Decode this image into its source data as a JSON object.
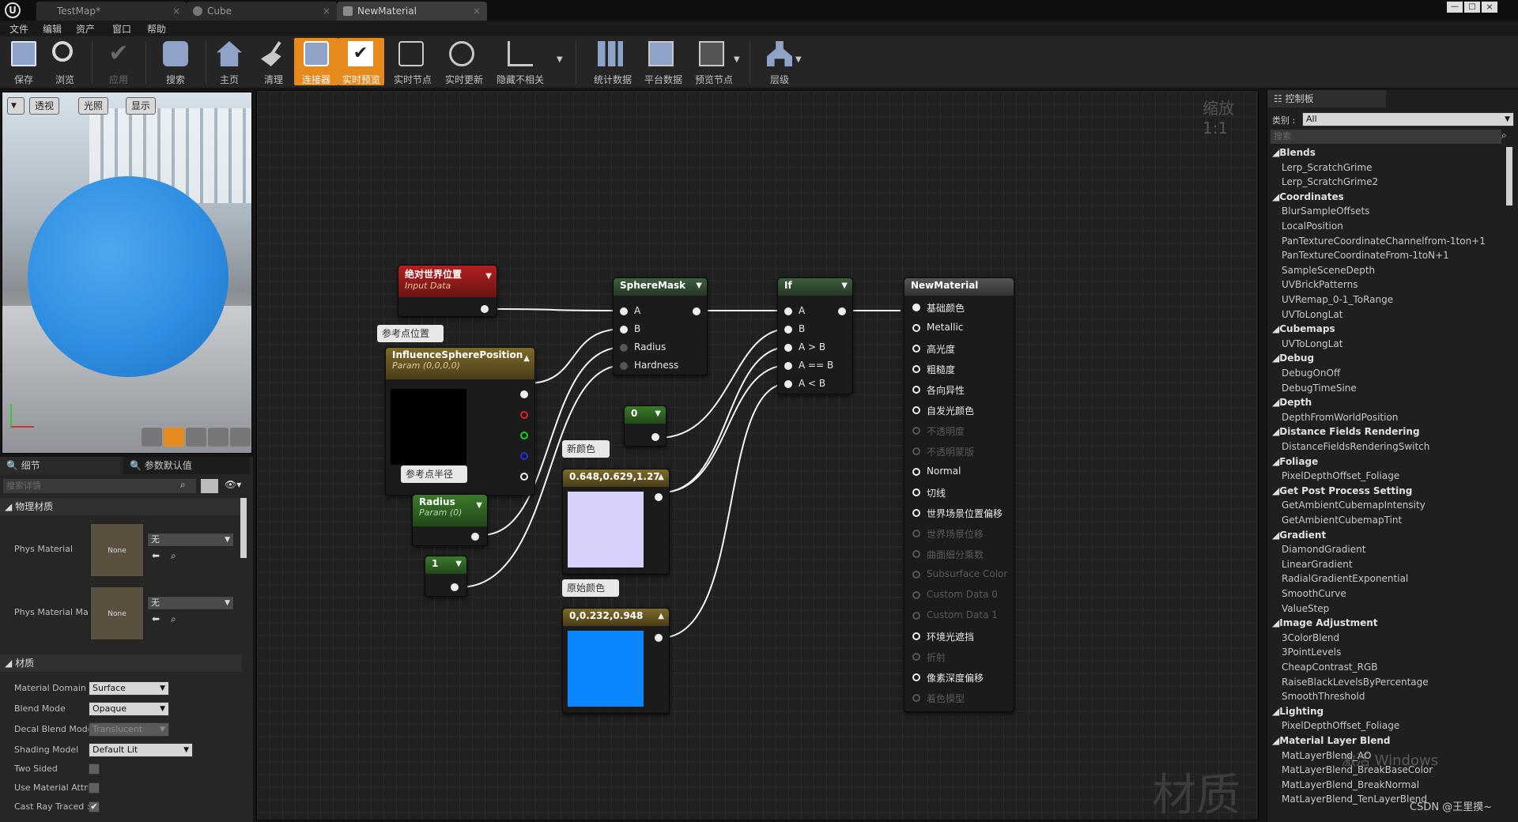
{
  "title_tabs": [
    {
      "label": "TestMap*"
    },
    {
      "label": "Cube"
    },
    {
      "label": "NewMaterial"
    }
  ],
  "menu": [
    "文件",
    "编辑",
    "资产",
    "窗口",
    "帮助"
  ],
  "toolbar": {
    "save": "保存",
    "browse": "浏览",
    "apply": "应用",
    "search": "搜索",
    "home": "主页",
    "clean": "清理",
    "connector": "连接器",
    "live_preview": "实时预览",
    "live_nodes": "实时节点",
    "live_update": "实时更新",
    "hide_unrelated": "隐藏不相关",
    "stats": "统计数据",
    "platform_stats": "平台数据",
    "preview_nodes": "预览节点",
    "hierarchy": "层级"
  },
  "viewport": {
    "perspective": "透视",
    "lit": "光照",
    "show": "显示"
  },
  "details": {
    "tab_details": "细节",
    "tab_params": "参数默认值",
    "search_placeholder": "搜索详情",
    "section_phys": "物理材质",
    "phys_material_label": "Phys Material",
    "phys_material_value": "无",
    "phys_material_thumb": "None",
    "phys_material_mask_label": "Phys Material Ma",
    "phys_material_mask_value": "无",
    "phys_material_mask_thumb": "None",
    "section_material": "材质",
    "domain_label": "Material Domain",
    "domain_value": "Surface",
    "blend_label": "Blend Mode",
    "blend_value": "Opaque",
    "decal_label": "Decal Blend Mode",
    "decal_value": "Translucent",
    "shading_label": "Shading Model",
    "shading_value": "Default Lit",
    "two_sided_label": "Two Sided",
    "use_attr_label": "Use Material Attri",
    "cast_ray_label": "Cast Ray Traced :"
  },
  "graph": {
    "zoom": "缩放1:1",
    "watermark": "材质",
    "node_world_pos": {
      "title": "绝对世界位置",
      "sub": "Input Data"
    },
    "comment_ref_pos": "参考点位置",
    "node_influence": {
      "title": "InfluenceSpherePosition",
      "sub": "Param (0,0,0,0)"
    },
    "comment_ref_radius": "参考点半径",
    "node_radius": {
      "title": "Radius",
      "sub": "Param (0)"
    },
    "node_const1": "1",
    "node_spheremask": {
      "title": "SphereMask",
      "pins": [
        "A",
        "B",
        "Radius",
        "Hardness"
      ]
    },
    "node_const0": "0",
    "comment_new_color": "新颜色",
    "node_color1": "0.648,0.629,1.27",
    "comment_orig_color": "原始颜色",
    "node_color2": "0,0.232,0.948",
    "node_if": {
      "title": "If",
      "pins": [
        "A",
        "B",
        "A > B",
        "A == B",
        "A < B"
      ]
    },
    "node_result": {
      "title": "NewMaterial",
      "pins": [
        "基础颜色",
        "Metallic",
        "高光度",
        "粗糙度",
        "各向异性",
        "自发光颜色",
        "不透明度",
        "不透明蒙版",
        "Normal",
        "切线",
        "世界场景位置偏移",
        "世界场景位移",
        "曲面细分乘数",
        "Subsurface Color",
        "Custom Data 0",
        "Custom Data 1",
        "环境光遮挡",
        "折射",
        "像素深度偏移",
        "着色模型"
      ]
    },
    "colors": {
      "swatch1": "#d6d2fb",
      "swatch2": "#0a86ff"
    }
  },
  "palette": {
    "tab": "控制板",
    "category_label": "类别 :",
    "category_value": "All",
    "search_placeholder": "搜索",
    "items": [
      {
        "t": "Blends",
        "cat": true
      },
      {
        "t": "Lerp_ScratchGrime"
      },
      {
        "t": "Lerp_ScratchGrime2"
      },
      {
        "t": "Coordinates",
        "cat": true
      },
      {
        "t": "BlurSampleOffsets"
      },
      {
        "t": "LocalPosition"
      },
      {
        "t": "PanTextureCoordinateChannelfrom-1ton+1"
      },
      {
        "t": "PanTextureCoordinateFrom-1toN+1"
      },
      {
        "t": "SampleSceneDepth"
      },
      {
        "t": "UVBrickPatterns"
      },
      {
        "t": "UVRemap_0-1_ToRange"
      },
      {
        "t": "UVToLongLat"
      },
      {
        "t": "Cubemaps",
        "cat": true
      },
      {
        "t": "UVToLongLat"
      },
      {
        "t": "Debug",
        "cat": true
      },
      {
        "t": "DebugOnOff"
      },
      {
        "t": "DebugTimeSine"
      },
      {
        "t": "Depth",
        "cat": true
      },
      {
        "t": "DepthFromWorldPosition"
      },
      {
        "t": "Distance Fields Rendering",
        "cat": true
      },
      {
        "t": "DistanceFieldsRenderingSwitch"
      },
      {
        "t": "Foliage",
        "cat": true
      },
      {
        "t": "PixelDepthOffset_Foliage"
      },
      {
        "t": "Get Post Process Setting",
        "cat": true
      },
      {
        "t": "GetAmbientCubemapIntensity"
      },
      {
        "t": "GetAmbientCubemapTint"
      },
      {
        "t": "Gradient",
        "cat": true
      },
      {
        "t": "DiamondGradient"
      },
      {
        "t": "LinearGradient"
      },
      {
        "t": "RadialGradientExponential"
      },
      {
        "t": "SmoothCurve"
      },
      {
        "t": "ValueStep"
      },
      {
        "t": "Image Adjustment",
        "cat": true
      },
      {
        "t": "3ColorBlend"
      },
      {
        "t": "3PointLevels"
      },
      {
        "t": "CheapContrast_RGB"
      },
      {
        "t": "RaiseBlackLevelsByPercentage"
      },
      {
        "t": "SmoothThreshold"
      },
      {
        "t": "Lighting",
        "cat": true
      },
      {
        "t": "PixelDepthOffset_Foliage"
      },
      {
        "t": "Material Layer Blend",
        "cat": true
      },
      {
        "t": "MatLayerBlend_AO"
      },
      {
        "t": "MatLayerBlend_BreakBaseColor"
      },
      {
        "t": "MatLayerBlend_BreakNormal"
      },
      {
        "t": "MatLayerBlend_TenLayerBlend"
      }
    ],
    "overlay_activate": "激活 Windows",
    "overlay_credit": "CSDN @王里摸~"
  }
}
